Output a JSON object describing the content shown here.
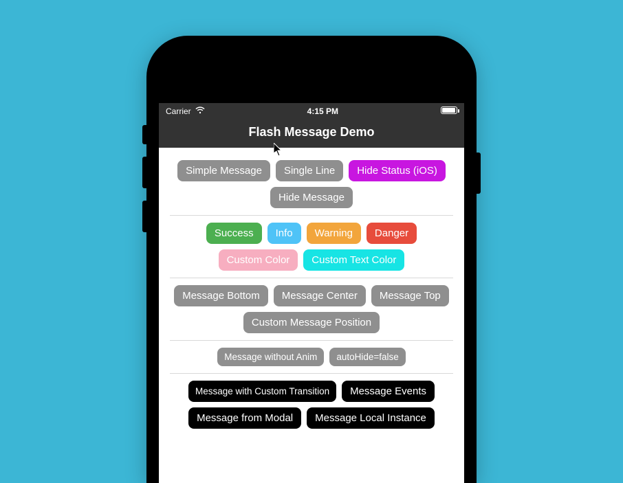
{
  "status_bar": {
    "carrier": "Carrier",
    "time": "4:15 PM"
  },
  "header": {
    "title": "Flash Message Demo"
  },
  "sections": [
    {
      "buttons": [
        {
          "label": "Simple Message",
          "style": "gray"
        },
        {
          "label": "Single Line",
          "style": "gray"
        },
        {
          "label": "Hide Status (iOS)",
          "style": "magenta"
        },
        {
          "label": "Hide Message",
          "style": "gray"
        }
      ]
    },
    {
      "buttons": [
        {
          "label": "Success",
          "style": "success"
        },
        {
          "label": "Info",
          "style": "info"
        },
        {
          "label": "Warning",
          "style": "warning"
        },
        {
          "label": "Danger",
          "style": "danger"
        },
        {
          "label": "Custom Color",
          "style": "pink"
        },
        {
          "label": "Custom Text Color",
          "style": "cyan"
        }
      ]
    },
    {
      "buttons": [
        {
          "label": "Message Bottom",
          "style": "gray"
        },
        {
          "label": "Message Center",
          "style": "gray"
        },
        {
          "label": "Message Top",
          "style": "gray"
        },
        {
          "label": "Custom Message Position",
          "style": "gray"
        }
      ]
    },
    {
      "buttons": [
        {
          "label": "Message without Anim",
          "style": "gray",
          "size": "sm"
        },
        {
          "label": "autoHide=false",
          "style": "gray",
          "size": "sm"
        }
      ]
    },
    {
      "buttons": [
        {
          "label": "Message with Custom Transition",
          "style": "black",
          "size": "sm"
        },
        {
          "label": "Message Events",
          "style": "black"
        },
        {
          "label": "Message from Modal",
          "style": "black"
        },
        {
          "label": "Message Local Instance",
          "style": "black"
        }
      ]
    }
  ]
}
